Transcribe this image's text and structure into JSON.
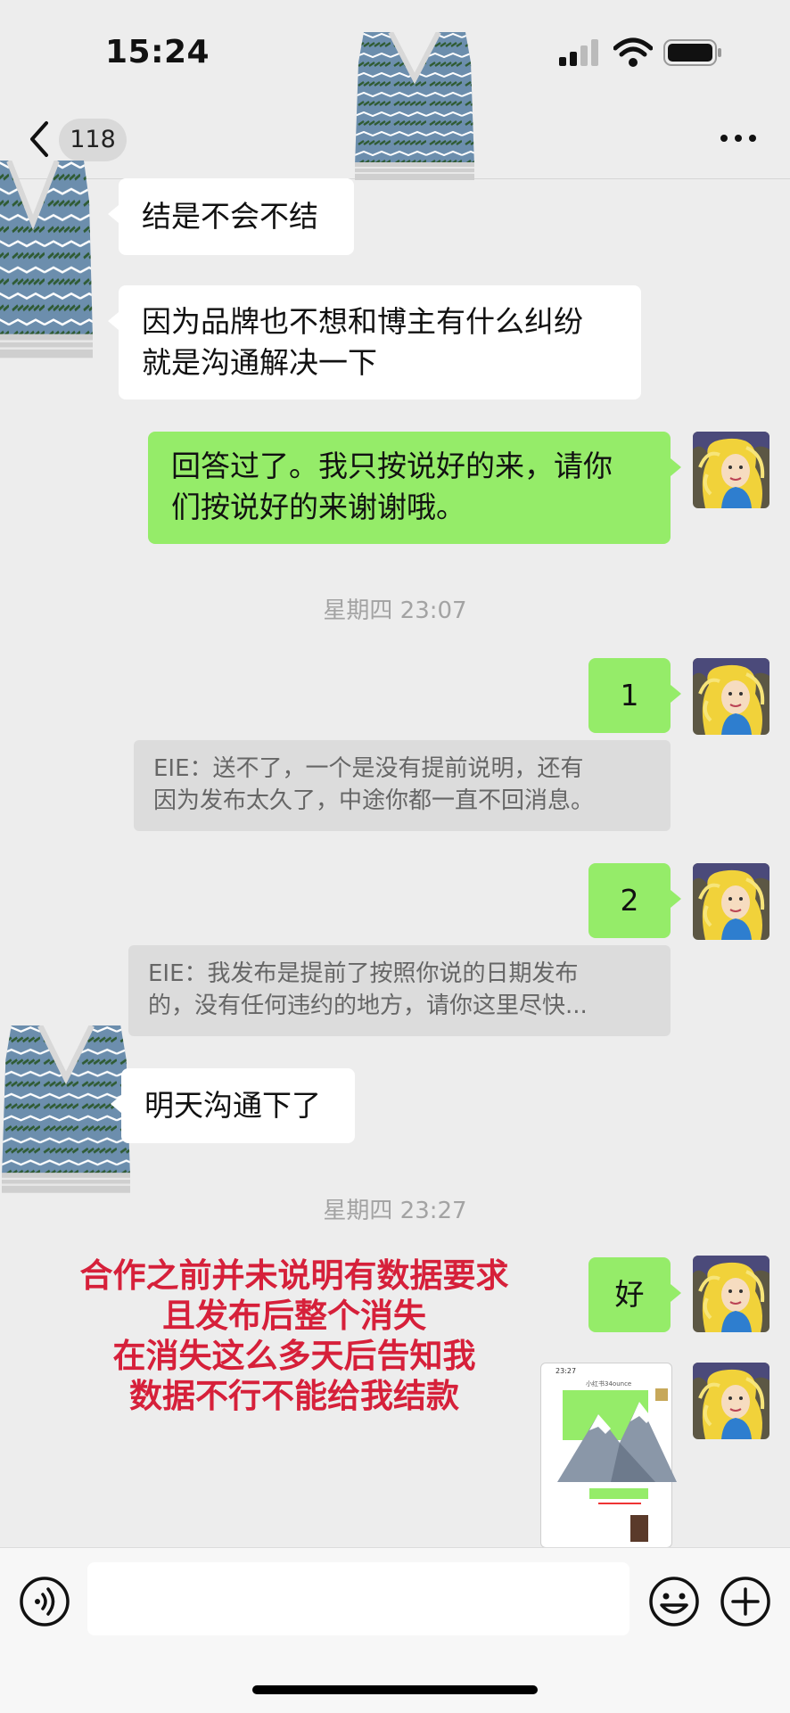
{
  "status_bar": {
    "time": "15:24"
  },
  "nav": {
    "badge": "118"
  },
  "messages": {
    "m1": "结是不会不结",
    "m2_line1": "因为品牌也不想和博主有什么纠纷",
    "m2_line2": "就是沟通解决一下",
    "m3_line1": "回答过了。我只按说好的来，请你",
    "m3_line2": "们按说好的来谢谢哦。",
    "ts1": "星期四 23:07",
    "m4": "1",
    "q1_line1": "EIE：送不了，一个是没有提前说明，还有",
    "q1_line2": "因为发布太久了，中途你都一直不回消息。",
    "m5": "2",
    "q2_line1": "EIE：我发布是提前了按照你说的日期发布",
    "q2_line2": "的，没有任何违约的地方，请你这里尽快...",
    "m6": "明天沟通下了",
    "ts2": "星期四 23:27",
    "m7": "好"
  },
  "overlay_text": "合作之前并未说明有数据要求\n且发布后整个消失\n在消失这么多天后告知我\n数据不行不能给我结款",
  "thumbnail": {
    "time": "23:27",
    "title": "小红书34ounce"
  },
  "colors": {
    "self_bubble": "#95ec69",
    "other_bubble": "#ffffff",
    "background": "#ededed",
    "overlay_text": "#d6203a"
  }
}
